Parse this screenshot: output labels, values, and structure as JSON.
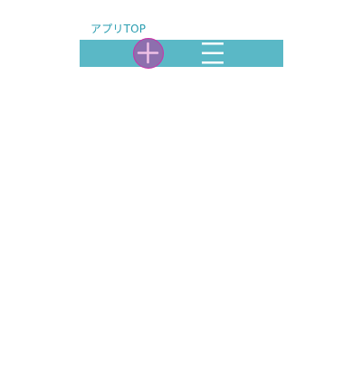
{
  "header": {
    "title": "アプリTOP"
  },
  "toolbar": {
    "add_icon": "plus-icon",
    "menu_icon": "hamburger-menu-icon"
  },
  "colors": {
    "title_text": "#2a9db0",
    "toolbar_bg": "#5ab8c6",
    "add_button_fill": "#8d6fae",
    "add_button_border": "#cc2fa8",
    "add_icon": "#efc0e6",
    "menu_icon": "#ffffff",
    "page_bg": "#ffffff"
  }
}
